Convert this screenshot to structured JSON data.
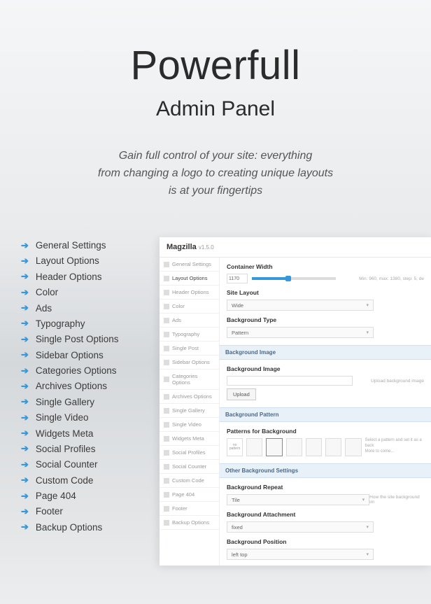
{
  "hero": {
    "title": "Powerfull",
    "subtitle": "Admin Panel",
    "desc_l1": "Gain full control of your site: everything",
    "desc_l2": "from changing a logo to creating unique layouts",
    "desc_l3": "is at your fingertips"
  },
  "features": [
    "General Settings",
    "Layout Options",
    "Header Options",
    "Color",
    "Ads",
    "Typography",
    "Single Post Options",
    "Sidebar Options",
    "Categories Options",
    "Archives Options",
    "Single Gallery",
    "Single Video",
    "Widgets Meta",
    "Social Profiles",
    "Social Counter",
    "Custom Code",
    "Page 404",
    "Footer",
    "Backup Options"
  ],
  "panel": {
    "brand": "Magzilla",
    "version": "v1.5.0",
    "sidebar": [
      "General Settings",
      "Layout Options",
      "Header Options",
      "Color",
      "Ads",
      "Typography",
      "Single Post",
      "Sidebar Options",
      "Categories Options",
      "Archives Options",
      "Single Gallery",
      "Single Video",
      "Widgets Meta",
      "Social Profiles",
      "Social Counter",
      "Custom Code",
      "Page 404",
      "Footer",
      "Backup Options"
    ],
    "active_index": 1,
    "container_width": {
      "label": "Container Width",
      "value": "1170",
      "helper": "Min: 960, max: 1380, step: 5, de"
    },
    "site_layout": {
      "label": "Site Layout",
      "value": "Wide"
    },
    "bg_type": {
      "label": "Background Type",
      "value": "Pattern"
    },
    "sec_bgimg": "Background Image",
    "bg_image": {
      "label": "Background Image",
      "btn": "Upload",
      "helper": "Upload background image"
    },
    "sec_bgpat": "Background Pattern",
    "patterns": {
      "label": "Patterns for Background",
      "none": "no pattern",
      "helper1": "Select a pattern and set it as a back",
      "helper2": "More to come..."
    },
    "sec_other": "Other Background Settings",
    "bg_repeat": {
      "label": "Background Repeat",
      "value": "Tile",
      "helper": "How the site background im"
    },
    "bg_attach": {
      "label": "Background Attachment",
      "value": "fixed"
    },
    "bg_pos": {
      "label": "Background Position",
      "value": "left top"
    }
  }
}
